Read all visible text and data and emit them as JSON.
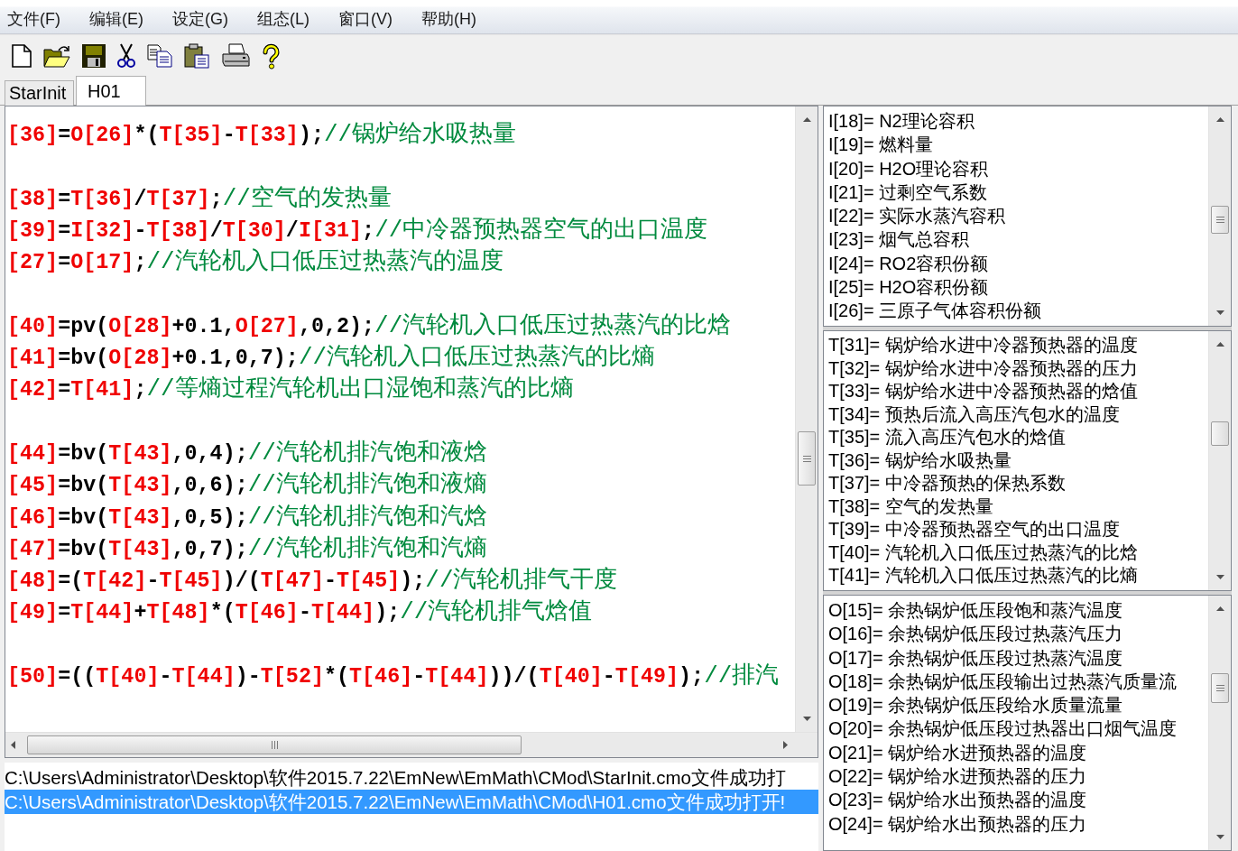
{
  "menu": [
    "文件(F)",
    "编辑(E)",
    "设定(G)",
    "组态(L)",
    "窗口(V)",
    "帮助(H)"
  ],
  "tabs": [
    {
      "label": "StarInit",
      "selected": false
    },
    {
      "label": "H01",
      "selected": true
    }
  ],
  "editor": {
    "blocks": [
      {
        "lines": [
          {
            "tokens": [
              {
                "kind": "var",
                "text": "[36]"
              },
              {
                "kind": "op",
                "text": "="
              },
              {
                "kind": "var",
                "text": "O[26]"
              },
              {
                "kind": "op",
                "text": "*("
              },
              {
                "kind": "var",
                "text": "T[35]"
              },
              {
                "kind": "op",
                "text": "-"
              },
              {
                "kind": "var",
                "text": "T[33]"
              },
              {
                "kind": "op",
                "text": ");"
              },
              {
                "kind": "comment",
                "text": "//锅炉给水吸热量"
              }
            ]
          }
        ]
      },
      {
        "lines": [
          {
            "tokens": [
              {
                "kind": "var",
                "text": "[38]"
              },
              {
                "kind": "op",
                "text": "="
              },
              {
                "kind": "var",
                "text": "T[36]"
              },
              {
                "kind": "op",
                "text": "/"
              },
              {
                "kind": "var",
                "text": "T[37]"
              },
              {
                "kind": "op",
                "text": ";"
              },
              {
                "kind": "comment",
                "text": "//空气的发热量"
              }
            ]
          },
          {
            "tokens": [
              {
                "kind": "var",
                "text": "[39]"
              },
              {
                "kind": "op",
                "text": "="
              },
              {
                "kind": "var",
                "text": "I[32]"
              },
              {
                "kind": "op",
                "text": "-"
              },
              {
                "kind": "var",
                "text": "T[38]"
              },
              {
                "kind": "op",
                "text": "/"
              },
              {
                "kind": "var",
                "text": "T[30]"
              },
              {
                "kind": "op",
                "text": "/"
              },
              {
                "kind": "var",
                "text": "I[31]"
              },
              {
                "kind": "op",
                "text": ";"
              },
              {
                "kind": "comment",
                "text": "//中冷器预热器空气的出口温度"
              }
            ]
          },
          {
            "tokens": [
              {
                "kind": "var",
                "text": "[27]"
              },
              {
                "kind": "op",
                "text": "="
              },
              {
                "kind": "var",
                "text": "O[17]"
              },
              {
                "kind": "op",
                "text": ";"
              },
              {
                "kind": "comment",
                "text": "//汽轮机入口低压过热蒸汽的温度"
              }
            ]
          }
        ]
      },
      {
        "lines": [
          {
            "tokens": [
              {
                "kind": "var",
                "text": "[40]"
              },
              {
                "kind": "op",
                "text": "=pv("
              },
              {
                "kind": "var",
                "text": "O[28]"
              },
              {
                "kind": "op",
                "text": "+0.1,"
              },
              {
                "kind": "var",
                "text": "O[27]"
              },
              {
                "kind": "op",
                "text": ",0,2);"
              },
              {
                "kind": "comment",
                "text": "//汽轮机入口低压过热蒸汽的比焓"
              }
            ]
          },
          {
            "tokens": [
              {
                "kind": "var",
                "text": "[41]"
              },
              {
                "kind": "op",
                "text": "=bv("
              },
              {
                "kind": "var",
                "text": "O[28]"
              },
              {
                "kind": "op",
                "text": "+0.1,0,7);"
              },
              {
                "kind": "comment",
                "text": "//汽轮机入口低压过热蒸汽的比熵"
              }
            ]
          },
          {
            "tokens": [
              {
                "kind": "var",
                "text": "[42]"
              },
              {
                "kind": "op",
                "text": "="
              },
              {
                "kind": "var",
                "text": "T[41]"
              },
              {
                "kind": "op",
                "text": ";"
              },
              {
                "kind": "comment",
                "text": "//等熵过程汽轮机出口湿饱和蒸汽的比熵"
              }
            ]
          }
        ]
      },
      {
        "lines": [
          {
            "tokens": [
              {
                "kind": "var",
                "text": "[44]"
              },
              {
                "kind": "op",
                "text": "=bv("
              },
              {
                "kind": "var",
                "text": "T[43]"
              },
              {
                "kind": "op",
                "text": ",0,4);"
              },
              {
                "kind": "comment",
                "text": "//汽轮机排汽饱和液焓"
              }
            ]
          },
          {
            "tokens": [
              {
                "kind": "var",
                "text": "[45]"
              },
              {
                "kind": "op",
                "text": "=bv("
              },
              {
                "kind": "var",
                "text": "T[43]"
              },
              {
                "kind": "op",
                "text": ",0,6);"
              },
              {
                "kind": "comment",
                "text": "//汽轮机排汽饱和液熵"
              }
            ]
          },
          {
            "tokens": [
              {
                "kind": "var",
                "text": "[46]"
              },
              {
                "kind": "op",
                "text": "=bv("
              },
              {
                "kind": "var",
                "text": "T[43]"
              },
              {
                "kind": "op",
                "text": ",0,5);"
              },
              {
                "kind": "comment",
                "text": "//汽轮机排汽饱和汽焓"
              }
            ]
          },
          {
            "tokens": [
              {
                "kind": "var",
                "text": "[47]"
              },
              {
                "kind": "op",
                "text": "=bv("
              },
              {
                "kind": "var",
                "text": "T[43]"
              },
              {
                "kind": "op",
                "text": ",0,7);"
              },
              {
                "kind": "comment",
                "text": "//汽轮机排汽饱和汽熵"
              }
            ]
          },
          {
            "tokens": [
              {
                "kind": "var",
                "text": "[48]"
              },
              {
                "kind": "op",
                "text": "=("
              },
              {
                "kind": "var",
                "text": "T[42]"
              },
              {
                "kind": "op",
                "text": "-"
              },
              {
                "kind": "var",
                "text": "T[45]"
              },
              {
                "kind": "op",
                "text": ")/("
              },
              {
                "kind": "var",
                "text": "T[47]"
              },
              {
                "kind": "op",
                "text": "-"
              },
              {
                "kind": "var",
                "text": "T[45]"
              },
              {
                "kind": "op",
                "text": ");"
              },
              {
                "kind": "comment",
                "text": "//汽轮机排气干度"
              }
            ]
          },
          {
            "tokens": [
              {
                "kind": "var",
                "text": "[49]"
              },
              {
                "kind": "op",
                "text": "="
              },
              {
                "kind": "var",
                "text": "T[44]"
              },
              {
                "kind": "op",
                "text": "+"
              },
              {
                "kind": "var",
                "text": "T[48]"
              },
              {
                "kind": "op",
                "text": "*("
              },
              {
                "kind": "var",
                "text": "T[46]"
              },
              {
                "kind": "op",
                "text": "-"
              },
              {
                "kind": "var",
                "text": "T[44]"
              },
              {
                "kind": "op",
                "text": ");"
              },
              {
                "kind": "comment",
                "text": "//汽轮机排气焓值"
              }
            ]
          }
        ]
      },
      {
        "lines": [
          {
            "tokens": [
              {
                "kind": "var",
                "text": "[50]"
              },
              {
                "kind": "op",
                "text": "=(("
              },
              {
                "kind": "var",
                "text": "T[40]"
              },
              {
                "kind": "op",
                "text": "-"
              },
              {
                "kind": "var",
                "text": "T[44]"
              },
              {
                "kind": "op",
                "text": ")-"
              },
              {
                "kind": "var",
                "text": "T[52]"
              },
              {
                "kind": "op",
                "text": "*("
              },
              {
                "kind": "var",
                "text": "T[46]"
              },
              {
                "kind": "op",
                "text": "-"
              },
              {
                "kind": "var",
                "text": "T[44]"
              },
              {
                "kind": "op",
                "text": "))/("
              },
              {
                "kind": "var",
                "text": "T[40]"
              },
              {
                "kind": "op",
                "text": "-"
              },
              {
                "kind": "var",
                "text": "T[49]"
              },
              {
                "kind": "op",
                "text": ");"
              },
              {
                "kind": "comment",
                "text": "//排汽"
              }
            ]
          }
        ]
      }
    ]
  },
  "log": [
    {
      "text": "C:\\Users\\Administrator\\Desktop\\软件2015.7.22\\EmNew\\EmMath\\CMod\\StarInit.cmo文件成功打",
      "selected": false
    },
    {
      "text": "C:\\Users\\Administrator\\Desktop\\软件2015.7.22\\EmNew\\EmMath\\CMod\\H01.cmo文件成功打开!",
      "selected": true
    }
  ],
  "variable_lists": [
    {
      "items": [
        "I[18]= N2理论容积",
        "I[19]= 燃料量",
        "I[20]= H2O理论容积",
        "I[21]= 过剩空气系数",
        "I[22]= 实际水蒸汽容积",
        "I[23]= 烟气总容积",
        "I[24]= RO2容积份额",
        "I[25]= H2O容积份额",
        "I[26]= 三原子气体容积份额"
      ]
    },
    {
      "items": [
        "T[31]= 锅炉给水进中冷器预热器的温度",
        "T[32]= 锅炉给水进中冷器预热器的压力",
        "T[33]= 锅炉给水进中冷器预热器的焓值",
        "T[34]= 预热后流入高压汽包水的温度",
        "T[35]= 流入高压汽包水的焓值",
        "T[36]= 锅炉给水吸热量",
        "T[37]= 中冷器预热的保热系数",
        "T[38]= 空气的发热量",
        "T[39]= 中冷器预热器空气的出口温度",
        "T[40]= 汽轮机入口低压过热蒸汽的比焓",
        "T[41]= 汽轮机入口低压过热蒸汽的比熵"
      ]
    },
    {
      "items": [
        "O[15]= 余热锅炉低压段饱和蒸汽温度",
        "O[16]= 余热锅炉低压段过热蒸汽压力",
        "O[17]= 余热锅炉低压段过热蒸汽温度",
        "O[18]= 余热锅炉低压段输出过热蒸汽质量流",
        "O[19]= 余热锅炉低压段给水质量流量",
        "O[20]= 余热锅炉低压段过热器出口烟气温度",
        "O[21]= 锅炉给水进预热器的温度",
        "O[22]= 锅炉给水进预热器的压力",
        "O[23]= 锅炉给水出预热器的温度",
        "O[24]= 锅炉给水出预热器的压力"
      ]
    }
  ]
}
